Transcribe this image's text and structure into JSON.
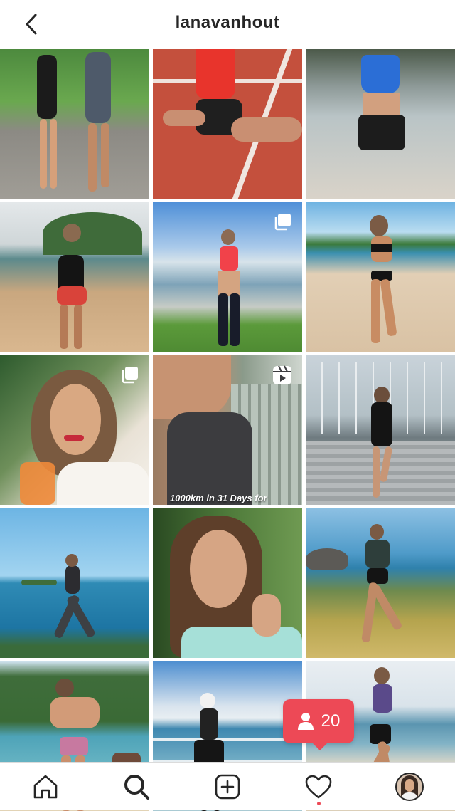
{
  "header": {
    "username": "lanavanhout"
  },
  "icons": {
    "back": "chevron-left-icon",
    "multi_post": "carousel-icon",
    "reel": "reel-icon",
    "home": "home-icon",
    "search": "search-icon",
    "new_post": "new-post-icon",
    "activity": "heart-icon",
    "profile": "profile-avatar"
  },
  "grid": {
    "tiles": [
      {
        "caption": ""
      },
      {
        "caption": ""
      },
      {
        "caption": ""
      },
      {
        "caption": ""
      },
      {
        "caption": ""
      },
      {
        "caption": ""
      },
      {
        "caption": ""
      },
      {
        "caption": "1000km in 31 Days for"
      },
      {
        "caption": ""
      },
      {
        "caption": ""
      },
      {
        "caption": ""
      },
      {
        "caption": ""
      },
      {
        "caption": ""
      },
      {
        "caption": ""
      },
      {
        "caption": ""
      }
    ]
  },
  "follow_notification": {
    "count": "20"
  },
  "colors": {
    "accent": "#ed4956",
    "text": "#262626"
  }
}
